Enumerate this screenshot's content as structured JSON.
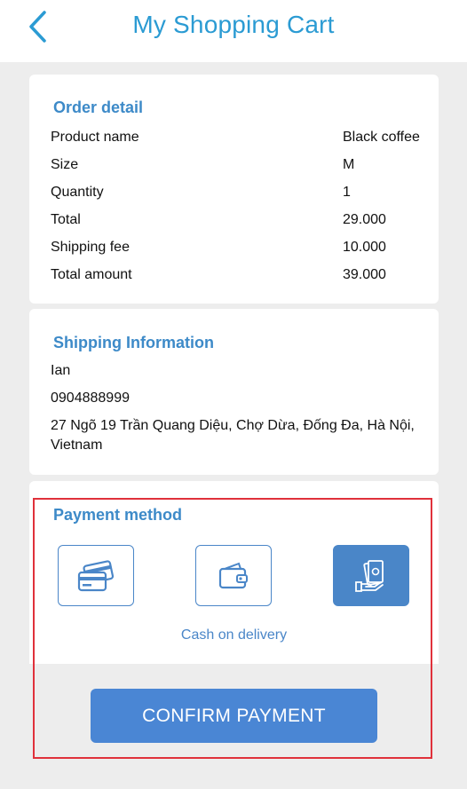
{
  "header": {
    "title": "My Shopping Cart"
  },
  "order": {
    "title": "Order detail",
    "rows": [
      {
        "label": "Product name",
        "value": "Black coffee"
      },
      {
        "label": "Size",
        "value": "M"
      },
      {
        "label": "Quantity",
        "value": "1"
      },
      {
        "label": "Total",
        "value": "29.000"
      },
      {
        "label": "Shipping fee",
        "value": "10.000"
      },
      {
        "label": "Total amount",
        "value": "39.000"
      }
    ]
  },
  "shipping": {
    "title": "Shipping Information",
    "name": "Ian",
    "phone": "0904888999",
    "address_line1": "27 Ngõ 19 Trần Quang Diệu, Chợ Dừa, Đống Đa, Hà Nội,",
    "address_line2": "Vietnam"
  },
  "payment": {
    "title": "Payment method",
    "options": [
      {
        "icon": "credit-card-icon",
        "selected": false
      },
      {
        "icon": "wallet-icon",
        "selected": false
      },
      {
        "icon": "cash-in-hand-icon",
        "selected": true
      }
    ],
    "selected_label": "Cash on delivery"
  },
  "confirm": {
    "label": "CONFIRM PAYMENT"
  },
  "colors": {
    "accent": "#4a86c8",
    "title": "#2b9bd3",
    "highlight": "#e0313b"
  }
}
